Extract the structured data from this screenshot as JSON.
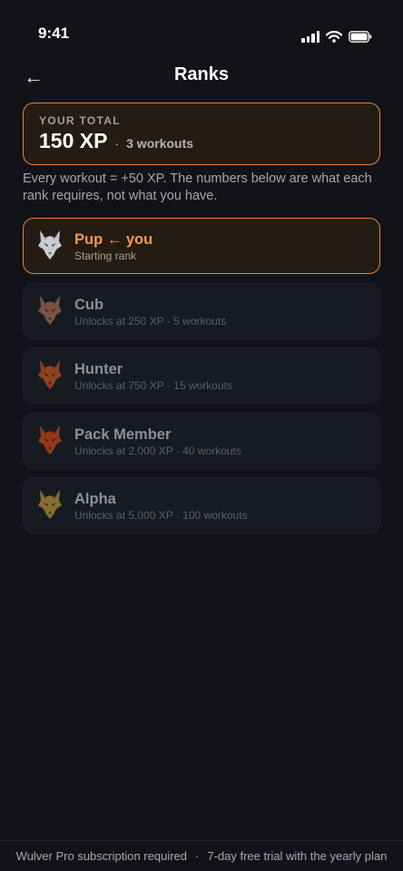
{
  "status": {
    "time": "9:41"
  },
  "header": {
    "title": "Ranks",
    "back_icon": "←"
  },
  "total": {
    "label": "YOUR TOTAL",
    "xp": "150 XP",
    "separator": "·",
    "workouts": "3 workouts"
  },
  "info": "Every workout = +50 XP. The numbers below are what each rank requires, not what you have.",
  "ranks": [
    {
      "name": "Pup ← you",
      "subtitle": "Starting rank",
      "current": true,
      "color": "#c9ccd6"
    },
    {
      "name": "Cub",
      "subtitle": "Unlocks at 250 XP · 5 workouts",
      "current": false,
      "color": "#8a6048"
    },
    {
      "name": "Hunter",
      "subtitle": "Unlocks at 750 XP · 15 workouts",
      "current": false,
      "color": "#a44a22"
    },
    {
      "name": "Pack Member",
      "subtitle": "Unlocks at 2,000 XP · 40 workouts",
      "current": false,
      "color": "#a83f18"
    },
    {
      "name": "Alpha",
      "subtitle": "Unlocks at 5,000 XP · 100 workouts",
      "current": false,
      "color": "#9a7c32"
    }
  ],
  "footer": {
    "left": "Wulver Pro subscription required",
    "separator": "·",
    "right": "7-day free trial with the yearly plan"
  },
  "colors": {
    "accent": "#e8823a",
    "accent_text": "#f59a52",
    "background": "#111318",
    "card": "#171a21"
  }
}
